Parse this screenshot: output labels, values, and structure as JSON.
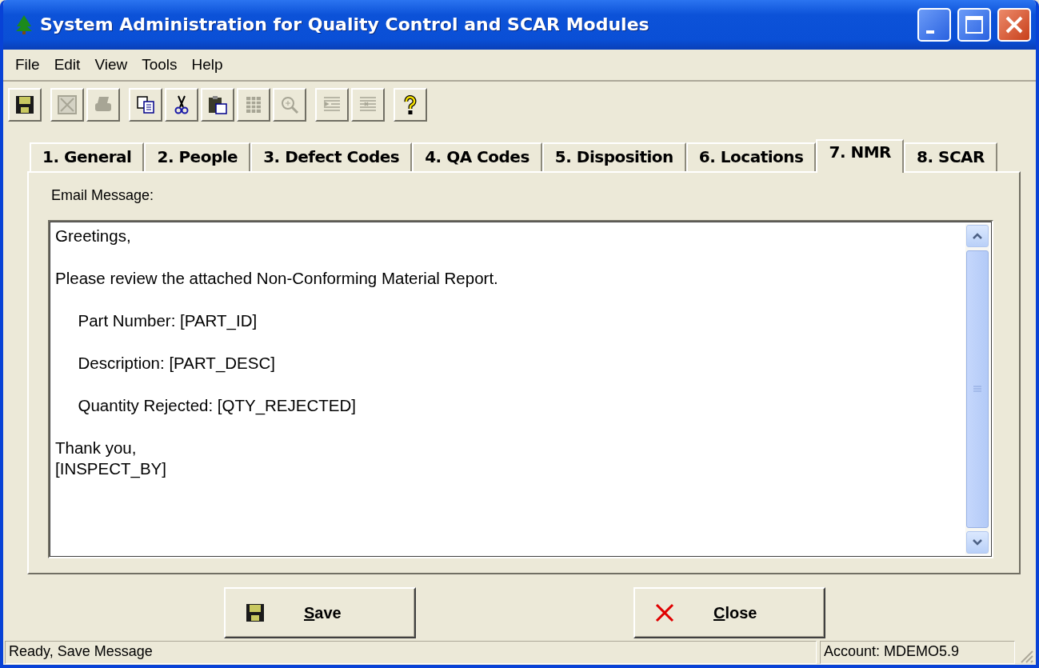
{
  "window": {
    "title": "System Administration for Quality Control and SCAR Modules"
  },
  "menu": [
    "File",
    "Edit",
    "View",
    "Tools",
    "Help"
  ],
  "toolbar": [
    {
      "kind": "save",
      "disabled": false
    },
    {
      "kind": "export",
      "disabled": true
    },
    {
      "kind": "print",
      "disabled": true
    },
    {
      "kind": "copy",
      "disabled": false
    },
    {
      "kind": "cut",
      "disabled": false
    },
    {
      "kind": "paste",
      "disabled": false
    },
    {
      "kind": "grid",
      "disabled": true
    },
    {
      "kind": "zoom",
      "disabled": true
    },
    {
      "kind": "indent",
      "disabled": true
    },
    {
      "kind": "outdent",
      "disabled": true
    },
    {
      "kind": "help",
      "disabled": false
    }
  ],
  "tabs": [
    {
      "label": "1. General",
      "selected": false
    },
    {
      "label": "2. People",
      "selected": false
    },
    {
      "label": "3. Defect Codes",
      "selected": false
    },
    {
      "label": "4. QA Codes",
      "selected": false
    },
    {
      "label": "5. Disposition",
      "selected": false
    },
    {
      "label": "6. Locations",
      "selected": false
    },
    {
      "label": "7. NMR",
      "selected": true
    },
    {
      "label": "8. SCAR",
      "selected": false
    }
  ],
  "email": {
    "label": "Email Message:",
    "value": "Greetings,\n\nPlease review the attached Non-Conforming Material Report.\n\n     Part Number: [PART_ID]\n\n     Description: [PART_DESC]\n\n     Quantity Rejected: [QTY_REJECTED]\n\nThank you,\n[INSPECT_BY]"
  },
  "buttons": [
    {
      "kind": "save",
      "label": "Save"
    },
    {
      "kind": "close",
      "label": "Close"
    }
  ],
  "status_bar": {
    "message": "Ready, Save Message",
    "account": "Account: MDEMO5.9"
  }
}
